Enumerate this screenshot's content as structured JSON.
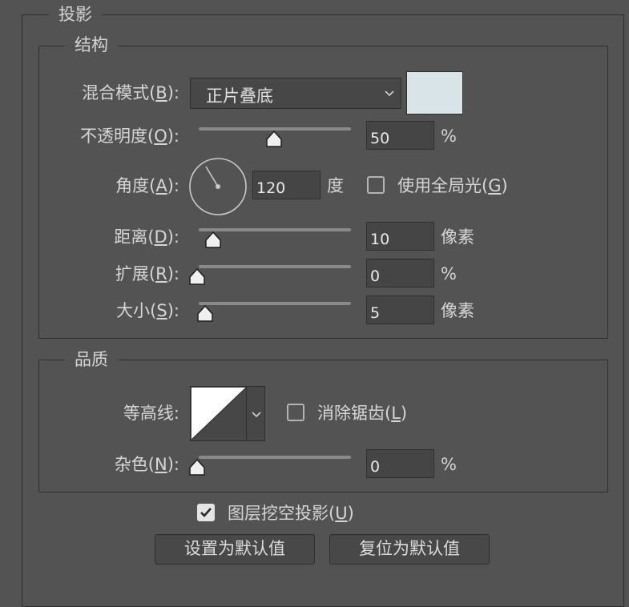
{
  "panel": {
    "title": "投影"
  },
  "structure": {
    "title": "结构",
    "blend_mode": {
      "label": "混合模式(",
      "key": "B",
      "suffix": "):",
      "value": "正片叠底",
      "color": "#d9e4e8"
    },
    "opacity": {
      "label": "不透明度(",
      "key": "O",
      "suffix": "):",
      "value": "50",
      "unit": "%",
      "level": 0.5
    },
    "angle": {
      "label": "角度(",
      "key": "A",
      "suffix": "):",
      "value": "120",
      "unit": "度",
      "degrees": 120
    },
    "global_light": {
      "label": "使用全局光(",
      "key": "G",
      "suffix": ")",
      "checked": false
    },
    "distance": {
      "label": "距离(",
      "key": "D",
      "suffix": "):",
      "value": "10",
      "unit": "像素",
      "level": 0.1
    },
    "spread": {
      "label": "扩展(",
      "key": "R",
      "suffix": "):",
      "value": "0",
      "unit": "%",
      "level": 0
    },
    "size": {
      "label": "大小(",
      "key": "S",
      "suffix": "):",
      "value": "5",
      "unit": "像素",
      "level": 0.05
    }
  },
  "quality": {
    "title": "品质",
    "contour": {
      "label": "等高线:"
    },
    "anti_alias": {
      "label": "消除锯齿(",
      "key": "L",
      "suffix": ")",
      "checked": false
    },
    "noise": {
      "label": "杂色(",
      "key": "N",
      "suffix": "):",
      "value": "0",
      "unit": "%",
      "level": 0
    }
  },
  "layer_knockout": {
    "label": "图层挖空投影(",
    "key": "U",
    "suffix": ")",
    "checked": true
  },
  "buttons": {
    "make_default": "设置为默认值",
    "reset_default": "复位为默认值"
  },
  "icons": {
    "dropdown": "chevron-down-icon",
    "check": "check-icon",
    "slider": "slider-thumb-icon"
  }
}
